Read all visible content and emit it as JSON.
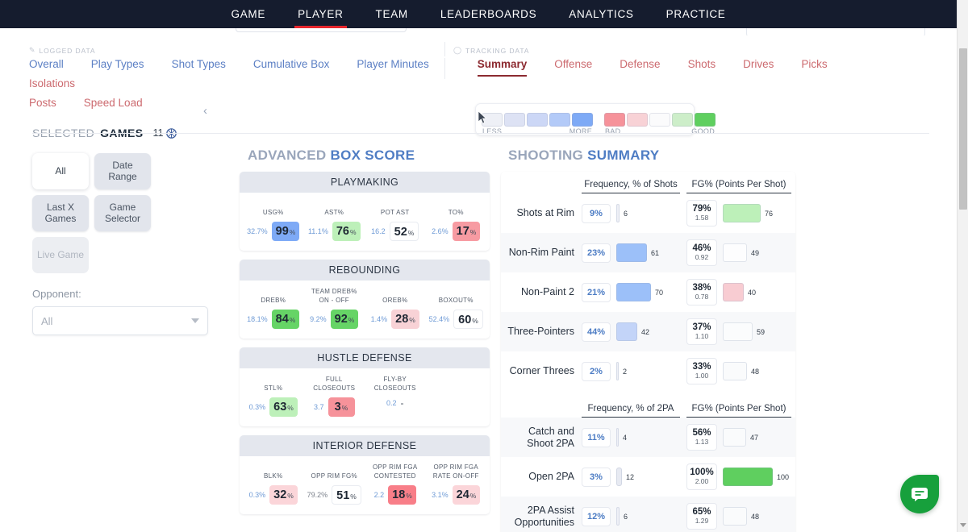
{
  "topnav": {
    "items": [
      {
        "label": "GAME",
        "active": false
      },
      {
        "label": "PLAYER",
        "active": true
      },
      {
        "label": "TEAM",
        "active": false
      },
      {
        "label": "LEADERBOARDS",
        "active": false
      },
      {
        "label": "ANALYTICS",
        "active": false
      },
      {
        "label": "PRACTICE",
        "active": false
      }
    ],
    "accent": "#e8262d",
    "background": "#151c2e"
  },
  "subnav": {
    "logged_group_label": "LOGGED DATA",
    "tracking_group_label": "TRACKING DATA",
    "logged_tabs": [
      {
        "label": "Overall",
        "active": false
      },
      {
        "label": "Play Types",
        "active": false
      },
      {
        "label": "Shot Types",
        "active": false
      },
      {
        "label": "Cumulative Box",
        "active": false
      },
      {
        "label": "Player Minutes",
        "active": false
      }
    ],
    "tracking_tabs": [
      {
        "label": "Summary",
        "active": true
      },
      {
        "label": "Offense",
        "active": false
      },
      {
        "label": "Defense",
        "active": false
      },
      {
        "label": "Shots",
        "active": false
      },
      {
        "label": "Drives",
        "active": false
      },
      {
        "label": "Picks",
        "active": false
      },
      {
        "label": "Isolations",
        "active": false
      },
      {
        "label": "Posts",
        "active": false
      },
      {
        "label": "Speed Load",
        "active": false
      }
    ]
  },
  "legend": {
    "volume_scale": {
      "left_label": "LESS",
      "right_label": "MORE",
      "colors": [
        "#eef0f6",
        "#dde2f4",
        "#ccd7f6",
        "#b3caf8",
        "#7eaaf6"
      ]
    },
    "quality_scale": {
      "left_label": "BAD",
      "right_label": "GOOD",
      "colors": [
        "#f6929a",
        "#f8d2d6",
        "#fbfbfc",
        "#cdeec9",
        "#5fcf5f"
      ]
    }
  },
  "sidebar": {
    "selected_prefix": "SELECTED",
    "selected_word": "GAMES",
    "selected_count": "11",
    "ball_icon": "basketball-icon",
    "buttons": [
      {
        "label": "All",
        "state": "selected"
      },
      {
        "label": "Date Range",
        "state": "normal"
      },
      {
        "label": "Last X Games",
        "state": "normal"
      },
      {
        "label": "Game Selector",
        "state": "normal"
      },
      {
        "label": "Live Game",
        "state": "disabled"
      }
    ],
    "opponent_label": "Opponent:",
    "opponent_value": "All"
  },
  "advanced_box_score": {
    "title_gray": "ADVANCED",
    "title_blue": "BOX SCORE",
    "cards": [
      {
        "title": "PLAYMAKING",
        "stats": [
          {
            "label": "USG%",
            "raw": "32.7%",
            "raw_style": "blue",
            "value": "99",
            "suffix": "%",
            "fill": "#7eaaf6"
          },
          {
            "label": "AST%",
            "raw": "11.1%",
            "raw_style": "blue",
            "value": "76",
            "suffix": "%",
            "fill": "#bdf0b9"
          },
          {
            "label": "POT AST",
            "raw": "16.2",
            "raw_style": "blue",
            "value": "52",
            "suffix": "%",
            "fill": "plain"
          },
          {
            "label": "TO%",
            "raw": "2.6%",
            "raw_style": "blue",
            "value": "17",
            "suffix": "%",
            "fill": "#f79ba2"
          }
        ]
      },
      {
        "title": "REBOUNDING",
        "stats": [
          {
            "label": "DREB%",
            "raw": "18.1%",
            "raw_style": "blue",
            "value": "84",
            "suffix": "%",
            "fill": "#66d466"
          },
          {
            "label": "TEAM DREB% ON - OFF",
            "raw": "9.2%",
            "raw_style": "blue",
            "value": "92",
            "suffix": "%",
            "fill": "#66d466"
          },
          {
            "label": "OREB%",
            "raw": "1.4%",
            "raw_style": "blue",
            "value": "28",
            "suffix": "%",
            "fill": "#f8d2d6"
          },
          {
            "label": "BOXOUT%",
            "raw": "52.4%",
            "raw_style": "blue",
            "value": "60",
            "suffix": "%",
            "fill": "plain"
          }
        ]
      },
      {
        "title": "HUSTLE DEFENSE",
        "stats": [
          {
            "label": "STL%",
            "raw": "0.3%",
            "raw_style": "blue",
            "value": "63",
            "suffix": "%",
            "fill": "#bdf0b9"
          },
          {
            "label": "FULL CLOSEOUTS",
            "raw": "3.7",
            "raw_style": "blue",
            "value": "3",
            "suffix": "%",
            "fill": "#f6929a"
          },
          {
            "label": "FLY-BY CLOSEOUTS",
            "raw": "0.2",
            "raw_style": "blue",
            "value": "-",
            "suffix": "",
            "fill": "none"
          },
          {
            "label": "",
            "raw": "",
            "raw_style": "blue",
            "value": "",
            "suffix": "",
            "fill": "none"
          }
        ]
      },
      {
        "title": "INTERIOR DEFENSE",
        "stats": [
          {
            "label": "BLK%",
            "raw": "0.3%",
            "raw_style": "blue",
            "value": "32",
            "suffix": "%",
            "fill": "#fbd5d9"
          },
          {
            "label": "OPP RIM FG%",
            "raw": "79.2%",
            "raw_style": "gray",
            "value": "51",
            "suffix": "%",
            "fill": "plain"
          },
          {
            "label": "OPP RIM FGA CONTESTED",
            "raw": "2.2",
            "raw_style": "blue",
            "value": "18",
            "suffix": "%",
            "fill": "#f87e88"
          },
          {
            "label": "OPP RIM FGA RATE ON-OFF",
            "raw": "3.1%",
            "raw_style": "blue",
            "value": "24",
            "suffix": "%",
            "fill": "#fbd5d9"
          }
        ]
      }
    ]
  },
  "shooting_summary": {
    "title_gray": "SHOOTING",
    "title_blue": "SUMMARY",
    "sections": [
      {
        "freq_header": "Frequency, % of Shots",
        "fg_header": "FG% (Points Per Shot)",
        "rows": [
          {
            "label": "Shots at Rim",
            "freq_pct": "9%",
            "freq_rank": "6",
            "freq_fill": "#eef0f6",
            "fg_pct": "79%",
            "pps": "1.58",
            "fg_rank": "76",
            "fg_fill": "#bdf0b9"
          },
          {
            "label": "Non-Rim Paint",
            "freq_pct": "23%",
            "freq_rank": "61",
            "freq_fill": "#9cc0f9",
            "fg_pct": "46%",
            "pps": "0.92",
            "fg_rank": "49",
            "fg_fill": "#fdfdfe"
          },
          {
            "label": "Non-Paint 2",
            "freq_pct": "21%",
            "freq_rank": "70",
            "freq_fill": "#9cc0f9",
            "fg_pct": "38%",
            "pps": "0.78",
            "fg_rank": "40",
            "fg_fill": "#f8ccd2"
          },
          {
            "label": "Three-Pointers",
            "freq_pct": "44%",
            "freq_rank": "42",
            "freq_fill": "#c3d4f8",
            "fg_pct": "37%",
            "pps": "1.10",
            "fg_rank": "59",
            "fg_fill": "#fbfcfd"
          },
          {
            "label": "Corner Threes",
            "freq_pct": "2%",
            "freq_rank": "2",
            "freq_fill": "#eef0f6",
            "fg_pct": "33%",
            "pps": "1.00",
            "fg_rank": "48",
            "fg_fill": "#fafbfc"
          }
        ]
      },
      {
        "freq_header": "Frequency, % of 2PA",
        "fg_header": "FG% (Points Per Shot)",
        "rows": [
          {
            "label": "Catch and Shoot 2PA",
            "freq_pct": "11%",
            "freq_rank": "4",
            "freq_fill": "#eef0f6",
            "fg_pct": "56%",
            "pps": "1.13",
            "fg_rank": "47",
            "fg_fill": "#fafbfc"
          },
          {
            "label": "Open 2PA",
            "freq_pct": "3%",
            "freq_rank": "12",
            "freq_fill": "#e7eaf2",
            "fg_pct": "100%",
            "pps": "2.00",
            "fg_rank": "100",
            "fg_fill": "#5fcf5f"
          },
          {
            "label": "2PA Assist Opportunities",
            "freq_pct": "12%",
            "freq_rank": "6",
            "freq_fill": "#eef0f6",
            "fg_pct": "65%",
            "pps": "1.29",
            "fg_rank": "48",
            "fg_fill": "#fafbfc"
          }
        ]
      }
    ]
  },
  "chat": {
    "icon": "chat-bubble-icon",
    "color": "#17a03c"
  }
}
